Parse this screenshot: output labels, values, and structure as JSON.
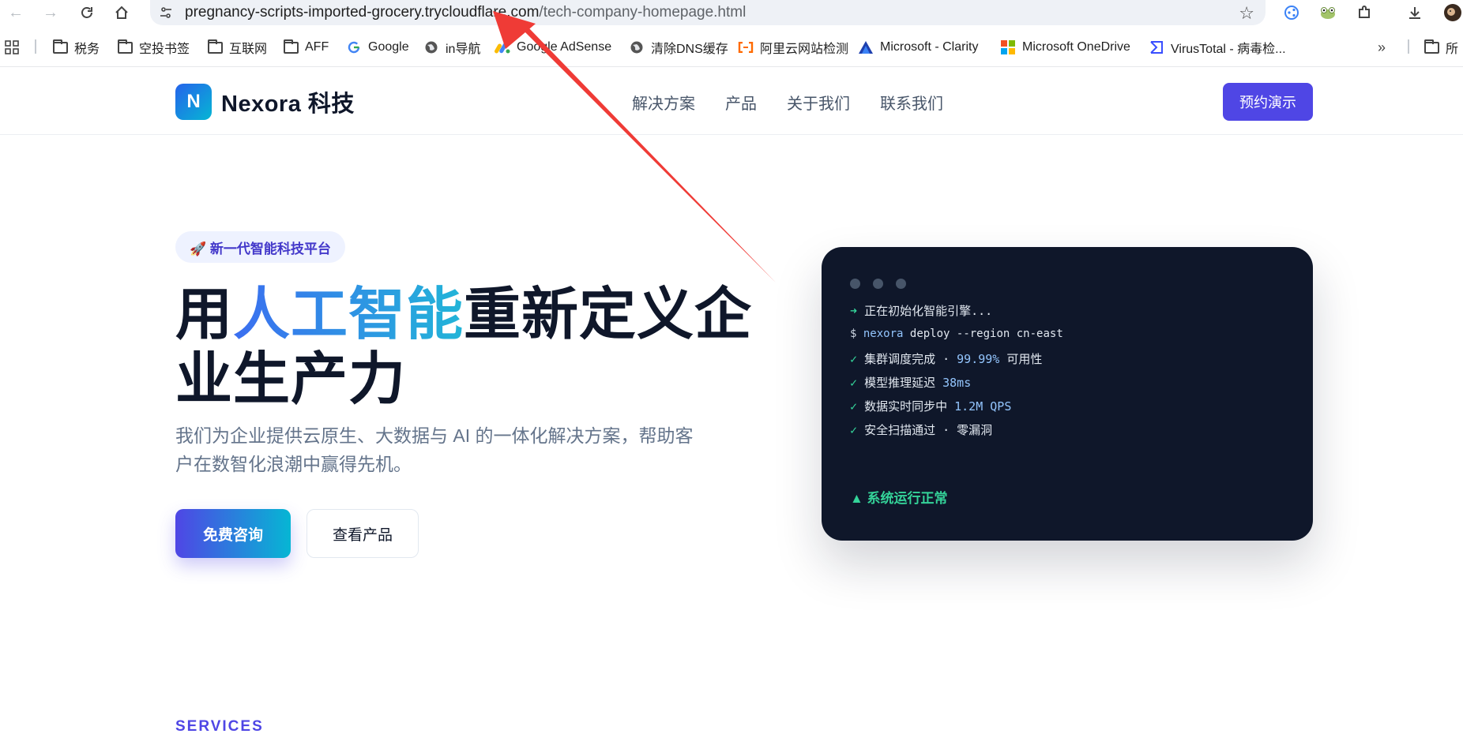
{
  "browser": {
    "url_host": "pregnancy-scripts-imported-grocery.trycloudflare.com",
    "url_path": "/tech-company-homepage.html",
    "bookmarks": [
      {
        "label": "税务",
        "icon": "folder-icon"
      },
      {
        "label": "空投书签",
        "icon": "folder-icon"
      },
      {
        "label": "互联网",
        "icon": "folder-icon"
      },
      {
        "label": "AFF",
        "icon": "folder-icon"
      },
      {
        "label": "Google",
        "icon": "google-icon"
      },
      {
        "label": "in导航",
        "icon": "globe-icon"
      },
      {
        "label": "Google AdSense",
        "icon": "adsense-icon"
      },
      {
        "label": "清除DNS缓存",
        "icon": "globe-icon"
      },
      {
        "label": "阿里云网站检测",
        "icon": "aliyun-icon"
      },
      {
        "label": "Microsoft - Clarity",
        "icon": "clarity-icon"
      },
      {
        "label": "Microsoft OneDrive",
        "icon": "microsoft-icon"
      },
      {
        "label": "VirusTotal - 病毒检...",
        "icon": "virustotal-icon"
      }
    ],
    "more_bookmarks": "所"
  },
  "site": {
    "logo_letter": "N",
    "brand": "Nexora 科技",
    "nav": [
      "解决方案",
      "产品",
      "关于我们",
      "联系我们"
    ],
    "demo_button": "预约演示"
  },
  "hero": {
    "badge": "🚀 新一代智能科技平台",
    "title_before": "用",
    "title_highlight": "人工智能",
    "title_after": "重新定义企业生产力",
    "subtitle": "我们为企业提供云原生、大数据与 AI 的一体化解决方案，帮助客户在数智化浪潮中赢得先机。",
    "primary_button": "免费咨询",
    "secondary_button": "查看产品"
  },
  "terminal": {
    "line1_prefix": "➜",
    "line1": "正在初始化智能引擎...",
    "line2_prefix": "$",
    "line2_cmd": "nexora",
    "line2_rest": "deploy --region cn-east",
    "line3_text": "集群调度完成 · ",
    "line3_value": "99.99%",
    "line3_suffix": " 可用性",
    "line4_text": "模型推理延迟 ",
    "line4_value": "38ms",
    "line5_text": "数据实时同步中 ",
    "line5_value": "1.2M QPS",
    "line6_text": "安全扫描通过 · 零漏洞",
    "check": "✓",
    "status": "▲  系统运行正常"
  },
  "section": {
    "services_label": "SERVICES"
  },
  "colors": {
    "brand_primary": "#4f46e5",
    "gradient_start": "#3b6ef0",
    "gradient_end": "#22b5d8",
    "terminal_bg": "#0f172a",
    "terminal_green": "#34d399",
    "annotation_red": "#ef3b36"
  }
}
